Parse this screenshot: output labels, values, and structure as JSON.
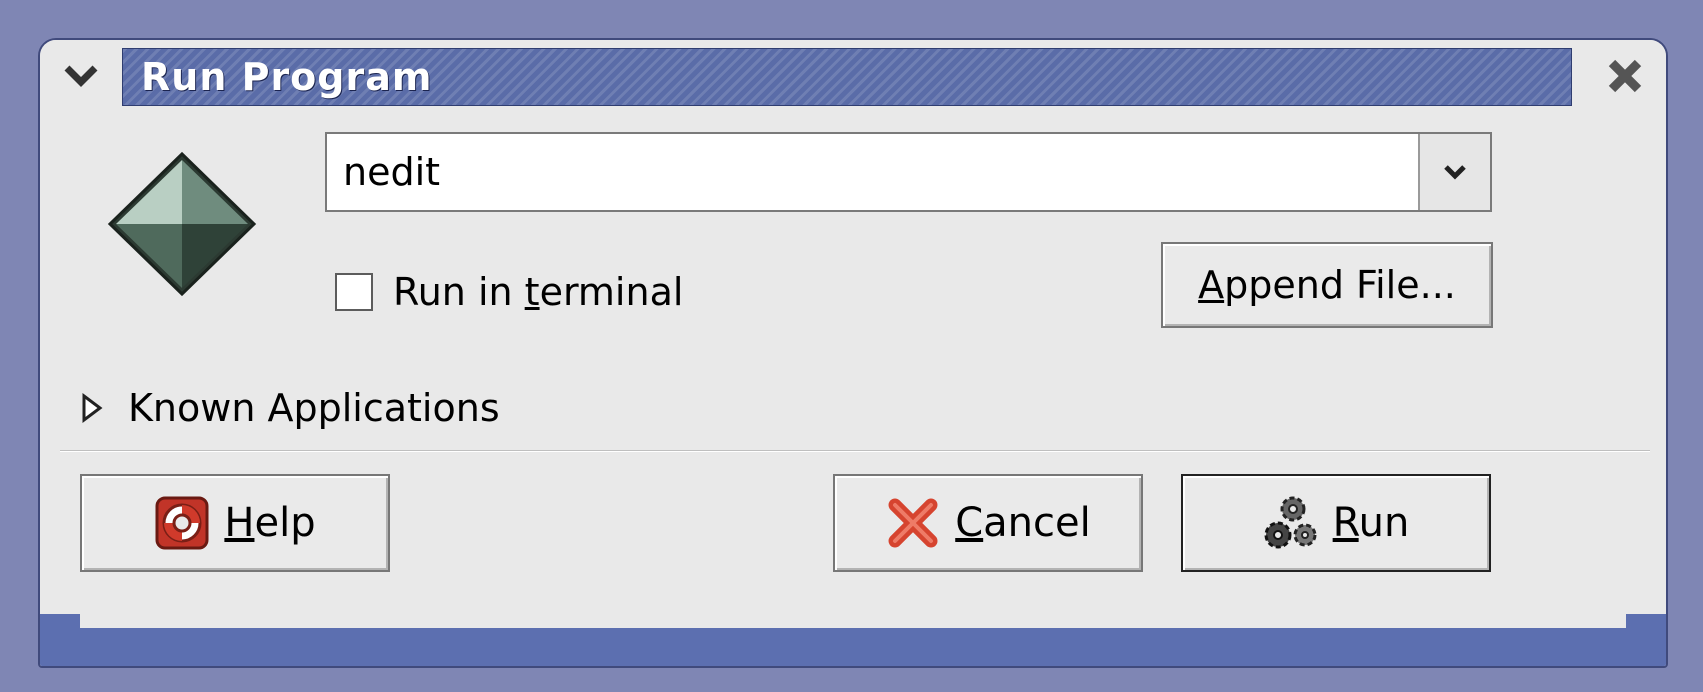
{
  "window": {
    "title": "Run Program",
    "menu_icon": "chevron-down-icon",
    "close_icon": "close-icon",
    "colors": {
      "title_bar": "#5a6ca8",
      "desktop": "#7f86b4",
      "dialog_bg": "#e9e9e9"
    }
  },
  "app_icon": "diamond-app-icon",
  "command": {
    "value": "nedit"
  },
  "run_in_terminal": {
    "label_before": "Run in ",
    "label_mnemonic": "t",
    "label_after": "erminal",
    "checked": false
  },
  "append_file": {
    "label_mnemonic": "A",
    "label_rest": "ppend File..."
  },
  "known_applications": {
    "label": "Known Applications",
    "expanded": false
  },
  "buttons": {
    "help": {
      "mnemonic": "H",
      "rest": "elp",
      "icon": "lifebuoy-icon"
    },
    "cancel": {
      "mnemonic": "C",
      "rest": "ancel",
      "icon": "cancel-x-icon"
    },
    "run": {
      "mnemonic": "R",
      "rest": "un",
      "icon": "gears-icon"
    }
  }
}
